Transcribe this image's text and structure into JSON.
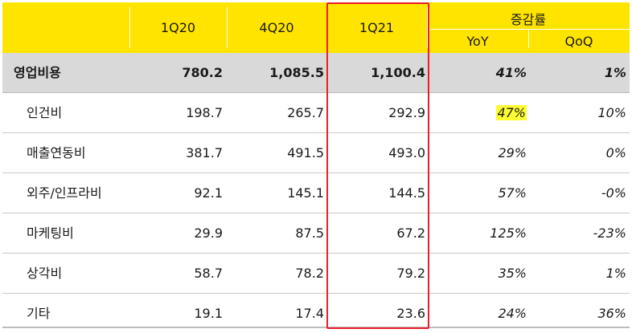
{
  "header": {
    "col_1q20": "1Q20",
    "col_4q20": "4Q20",
    "col_1q21": "1Q21",
    "group_label": "증감률",
    "col_yoy": "YoY",
    "col_qoq": "QoQ"
  },
  "colors": {
    "header_bg": "#ffe400",
    "total_row_bg": "#d9d9d9",
    "highlight": "#ffff33",
    "focus_border": "#e8202a"
  },
  "rows": [
    {
      "label": "영업비용",
      "q1_20": "780.2",
      "q4_20": "1,085.5",
      "q1_21": "1,100.4",
      "yoy": "41%",
      "qoq": "1%"
    },
    {
      "label": "인건비",
      "q1_20": "198.7",
      "q4_20": "265.7",
      "q1_21": "292.9",
      "yoy": "47%",
      "qoq": "10%"
    },
    {
      "label": "매출연동비",
      "q1_20": "381.7",
      "q4_20": "491.5",
      "q1_21": "493.0",
      "yoy": "29%",
      "qoq": "0%"
    },
    {
      "label": "외주/인프라비",
      "q1_20": "92.1",
      "q4_20": "145.1",
      "q1_21": "144.5",
      "yoy": "57%",
      "qoq": "-0%"
    },
    {
      "label": "마케팅비",
      "q1_20": "29.9",
      "q4_20": "87.5",
      "q1_21": "67.2",
      "yoy": "125%",
      "qoq": "-23%"
    },
    {
      "label": "상각비",
      "q1_20": "58.7",
      "q4_20": "78.2",
      "q1_21": "79.2",
      "yoy": "35%",
      "qoq": "1%"
    },
    {
      "label": "기타",
      "q1_20": "19.1",
      "q4_20": "17.4",
      "q1_21": "23.6",
      "yoy": "24%",
      "qoq": "36%"
    }
  ]
}
